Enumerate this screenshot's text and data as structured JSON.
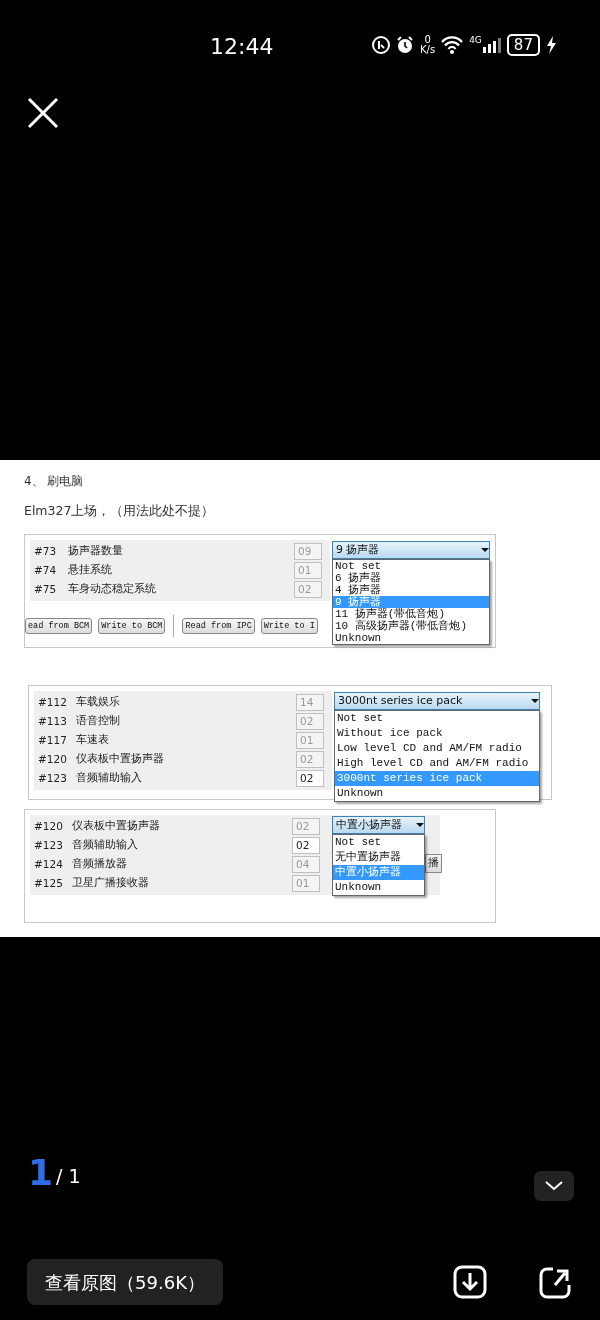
{
  "status_bar": {
    "time": "12:44",
    "speed_value": "0",
    "speed_unit": "K/s",
    "network_type": "4G",
    "battery": "87"
  },
  "article": {
    "heading": "4、 刷电脑",
    "intro": "Elm327上场，（用法此处不提）"
  },
  "panels": [
    {
      "rows": [
        {
          "number": "#73",
          "name": "扬声器数量",
          "code": "09",
          "disabled": true
        },
        {
          "number": "#74",
          "name": "悬挂系统",
          "code": "01",
          "disabled": true
        },
        {
          "number": "#75",
          "name": "车身动态稳定系统",
          "code": "02",
          "disabled": true
        }
      ],
      "combo": {
        "value": "9 扬声器",
        "options": [
          {
            "label": "Not set",
            "selected": false
          },
          {
            "label": "6 扬声器",
            "selected": false
          },
          {
            "label": "4 扬声器",
            "selected": false
          },
          {
            "label": "9 扬声器",
            "selected": true
          },
          {
            "label": "11 扬声器(带低音炮)",
            "selected": false
          },
          {
            "label": "10 高级扬声器(带低音炮)",
            "selected": false
          },
          {
            "label": "Unknown",
            "selected": false
          }
        ]
      },
      "buttons": [
        "ead from BCM",
        "Write to BCM",
        "Read from IPC",
        "Write to I"
      ]
    },
    {
      "rows": [
        {
          "number": "#112",
          "name": "车载娱乐",
          "code": "14",
          "disabled": true
        },
        {
          "number": "#113",
          "name": "语音控制",
          "code": "02",
          "disabled": true
        },
        {
          "number": "#117",
          "name": "车速表",
          "code": "01",
          "disabled": true
        },
        {
          "number": "#120",
          "name": "仪表板中置扬声器",
          "code": "02",
          "disabled": true
        },
        {
          "number": "#123",
          "name": "音频辅助输入",
          "code": "02",
          "disabled": false
        }
      ],
      "combo": {
        "value": "3000nt series ice pack",
        "options": [
          {
            "label": "Not set",
            "selected": false
          },
          {
            "label": "Without ice pack",
            "selected": false
          },
          {
            "label": "Low level CD and AM/FM radio",
            "selected": false
          },
          {
            "label": "High level CD and AM/FM radio",
            "selected": false
          },
          {
            "label": "3000nt series ice pack",
            "selected": true
          },
          {
            "label": "Unknown",
            "selected": false
          }
        ]
      }
    },
    {
      "rows": [
        {
          "number": "#120",
          "name": "仪表板中置扬声器",
          "code": "02",
          "disabled": true
        },
        {
          "number": "#123",
          "name": "音频辅助输入",
          "code": "02",
          "disabled": false
        },
        {
          "number": "#124",
          "name": "音频播放器",
          "code": "04",
          "disabled": true
        },
        {
          "number": "#125",
          "name": "卫星广播接收器",
          "code": "01",
          "disabled": true
        }
      ],
      "combo": {
        "value": "中置小扬声器",
        "options": [
          {
            "label": "Not set",
            "selected": false
          },
          {
            "label": "无中置扬声器",
            "selected": false
          },
          {
            "label": "中置小扬声器",
            "selected": true
          },
          {
            "label": "Unknown",
            "selected": false
          }
        ]
      },
      "side_combo": "播"
    }
  ],
  "viewer": {
    "page_index": "1",
    "page_total": "/ 1",
    "view_original": "查看原图（59.6K）"
  }
}
